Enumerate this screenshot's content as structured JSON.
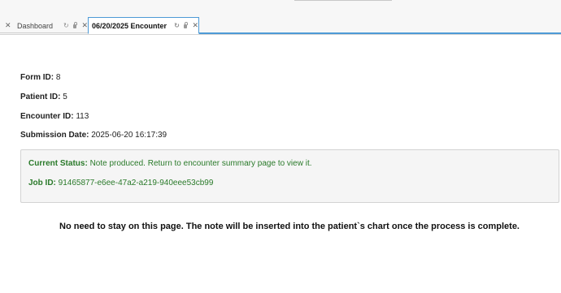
{
  "tabs": [
    {
      "label": "",
      "partial": true
    },
    {
      "label": "Dashboard",
      "active": false
    },
    {
      "label": "06/20/2025 Encounter",
      "active": true
    }
  ],
  "icons": {
    "close": "close-icon",
    "refresh": "refresh-icon",
    "lock": "lock-icon"
  },
  "form": {
    "form_id_label": "Form ID:",
    "form_id_value": "8",
    "patient_id_label": "Patient ID:",
    "patient_id_value": "5",
    "encounter_id_label": "Encounter ID:",
    "encounter_id_value": "113",
    "submission_date_label": "Submission Date:",
    "submission_date_value": "2025-06-20 16:17:39"
  },
  "status": {
    "current_status_label": "Current Status:",
    "current_status_value": "Note produced. Return to encounter summary page to view it.",
    "job_id_label": "Job ID:",
    "job_id_value": "91465877-e6ee-47a2-a219-940eee53cb99"
  },
  "notice": "No need to stay on this page. The note will be inserted into the patient`s chart once the process is complete.",
  "colors": {
    "accent": "#4d9ad6",
    "status_text": "#2a7a2a",
    "status_bg": "#f5f5f5"
  }
}
